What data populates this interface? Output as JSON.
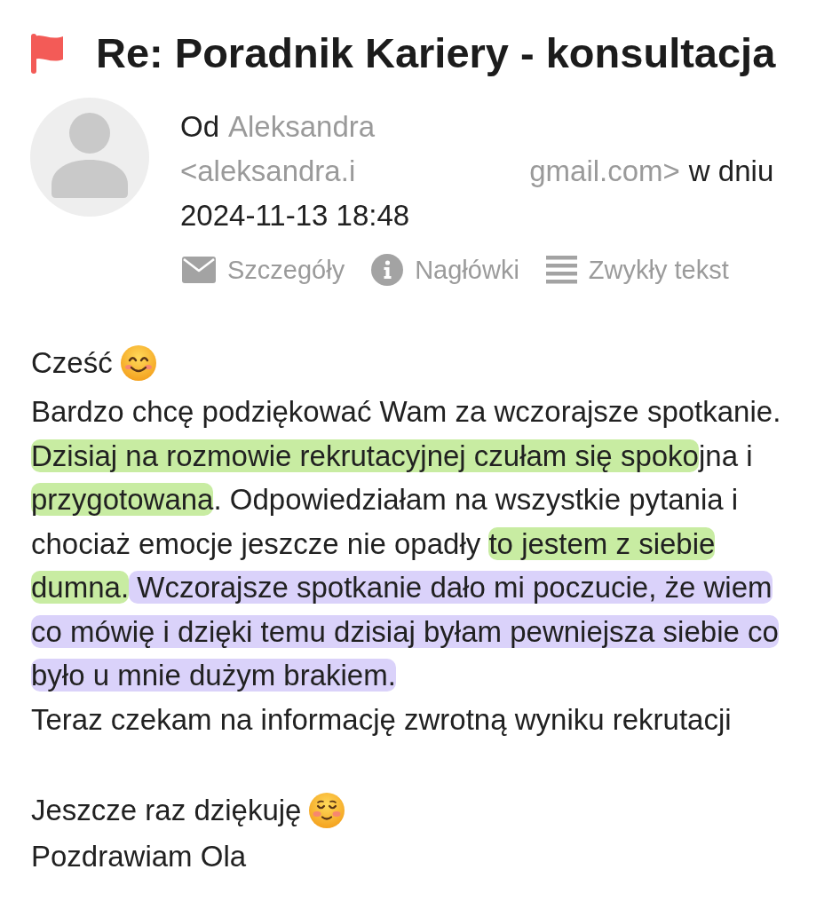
{
  "message": {
    "flagged": true,
    "subject": "Re: Poradnik Kariery - konsultacja"
  },
  "sender": {
    "from_label": "Od",
    "name": "Aleksandra",
    "email_start": "<aleksandra.i",
    "email_end": "gmail.com>",
    "date_label": "w dniu",
    "date": "2024-11-13 18:48"
  },
  "actions": [
    {
      "kind": "details",
      "label": "Szczegóły"
    },
    {
      "kind": "headers",
      "label": "Nagłówki"
    },
    {
      "kind": "plain_text",
      "label": "Zwykły tekst"
    }
  ],
  "body": {
    "greeting": "Cześć",
    "paragraphs": [
      {
        "segments": [
          {
            "text": "Bardzo chcę podziękować Wam za wczorajsze spotkanie. "
          },
          {
            "text": "Dzisiaj na rozmowie rekrutacyjnej czułam się spoko",
            "color": "#c8eca2"
          },
          {
            "text": "jna i "
          },
          {
            "text": "przygotowana",
            "color": "#c8eca2"
          },
          {
            "text": ". Odpowiedziałam na wszystkie pytania i chociaż emocje jeszcze nie opadły "
          },
          {
            "text": "to jestem z siebie dumna.",
            "color": "#c8eca2"
          },
          {
            "text": " Wczorajsze spotkanie dało mi poczucie, że wiem co mówię i dzięki temu dzisiaj byłam pewniejsza siebie co było u mnie dużym brakiem.",
            "color": "#dad2fa"
          }
        ]
      },
      {
        "segments": [
          {
            "text": "Teraz czekam na informację zwrotną wyniku rekrutacji"
          }
        ]
      }
    ],
    "closing": [
      "Jeszcze raz dziękuję",
      "Pozdrawiam Ola"
    ]
  }
}
